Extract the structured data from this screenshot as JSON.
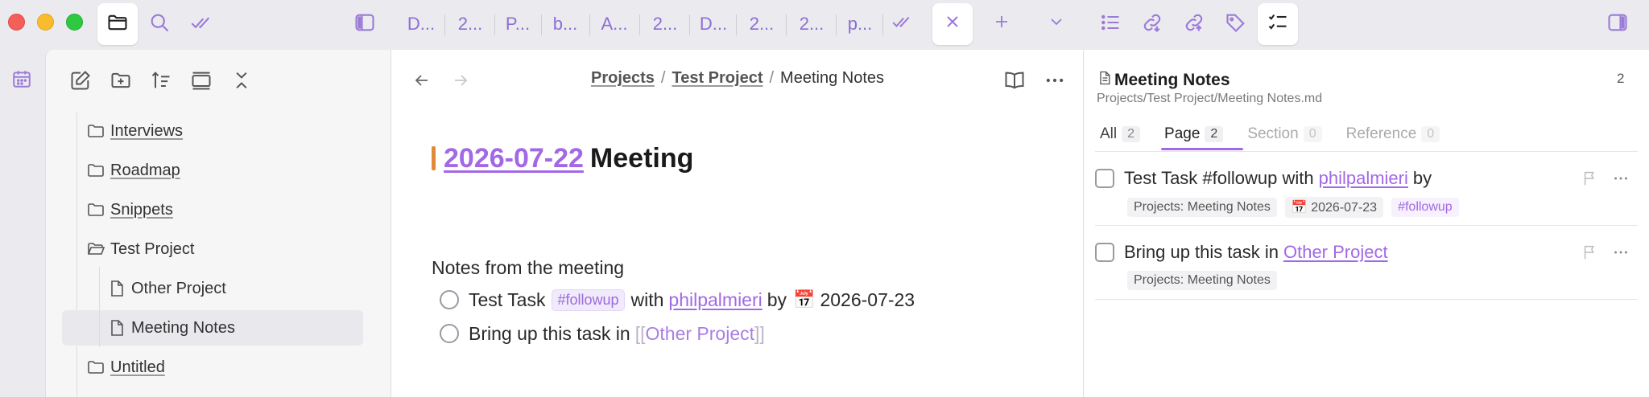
{
  "tabs": [
    "D...",
    "2...",
    "P...",
    "b...",
    "A...",
    "2...",
    "D...",
    "2...",
    "2...",
    "p..."
  ],
  "sidebar": {
    "items": [
      {
        "label": "Interviews",
        "type": "folder"
      },
      {
        "label": "Roadmap",
        "type": "folder"
      },
      {
        "label": "Snippets",
        "type": "folder"
      },
      {
        "label": "Test Project",
        "type": "folder-open"
      },
      {
        "label": "Other Project",
        "type": "file"
      },
      {
        "label": "Meeting Notes",
        "type": "file"
      },
      {
        "label": "Untitled",
        "type": "folder"
      }
    ]
  },
  "editor": {
    "breadcrumb": {
      "root": "Projects",
      "sep1": "/",
      "mid": "Test Project",
      "sep2": "/",
      "current": "Meeting Notes"
    },
    "heading": {
      "date": "2026-07-22",
      "rest": "Meeting"
    },
    "paragraph": "Notes from the meeting",
    "task1": {
      "text": "Test Task",
      "tag": "#followup",
      "with": "with",
      "user": "philpalmieri",
      "by": "by",
      "cal_icon": "📅",
      "date": "2026-07-23"
    },
    "task2": {
      "text": "Bring up this task in",
      "open": "[[",
      "link": "Other Project",
      "close": "]]"
    }
  },
  "right_pane": {
    "title": "Meeting Notes",
    "count": "2",
    "path": "Projects/Test Project/Meeting Notes.md",
    "tabs": [
      {
        "label": "All",
        "count": "2"
      },
      {
        "label": "Page",
        "count": "2"
      },
      {
        "label": "Section",
        "count": "0"
      },
      {
        "label": "Reference",
        "count": "0"
      }
    ],
    "task1": {
      "text": "Test Task #followup with",
      "user": "philpalmieri",
      "by": "by",
      "chip_source": "Projects: Meeting Notes",
      "cal_icon": "📅",
      "chip_date": "2026-07-23",
      "chip_tag": "#followup"
    },
    "task2": {
      "text": "Bring up this task in",
      "link": "Other Project",
      "chip_source": "Projects: Meeting Notes"
    }
  },
  "colors": {
    "accent": "#a268e6",
    "heading_bar": "#e08a3c"
  }
}
